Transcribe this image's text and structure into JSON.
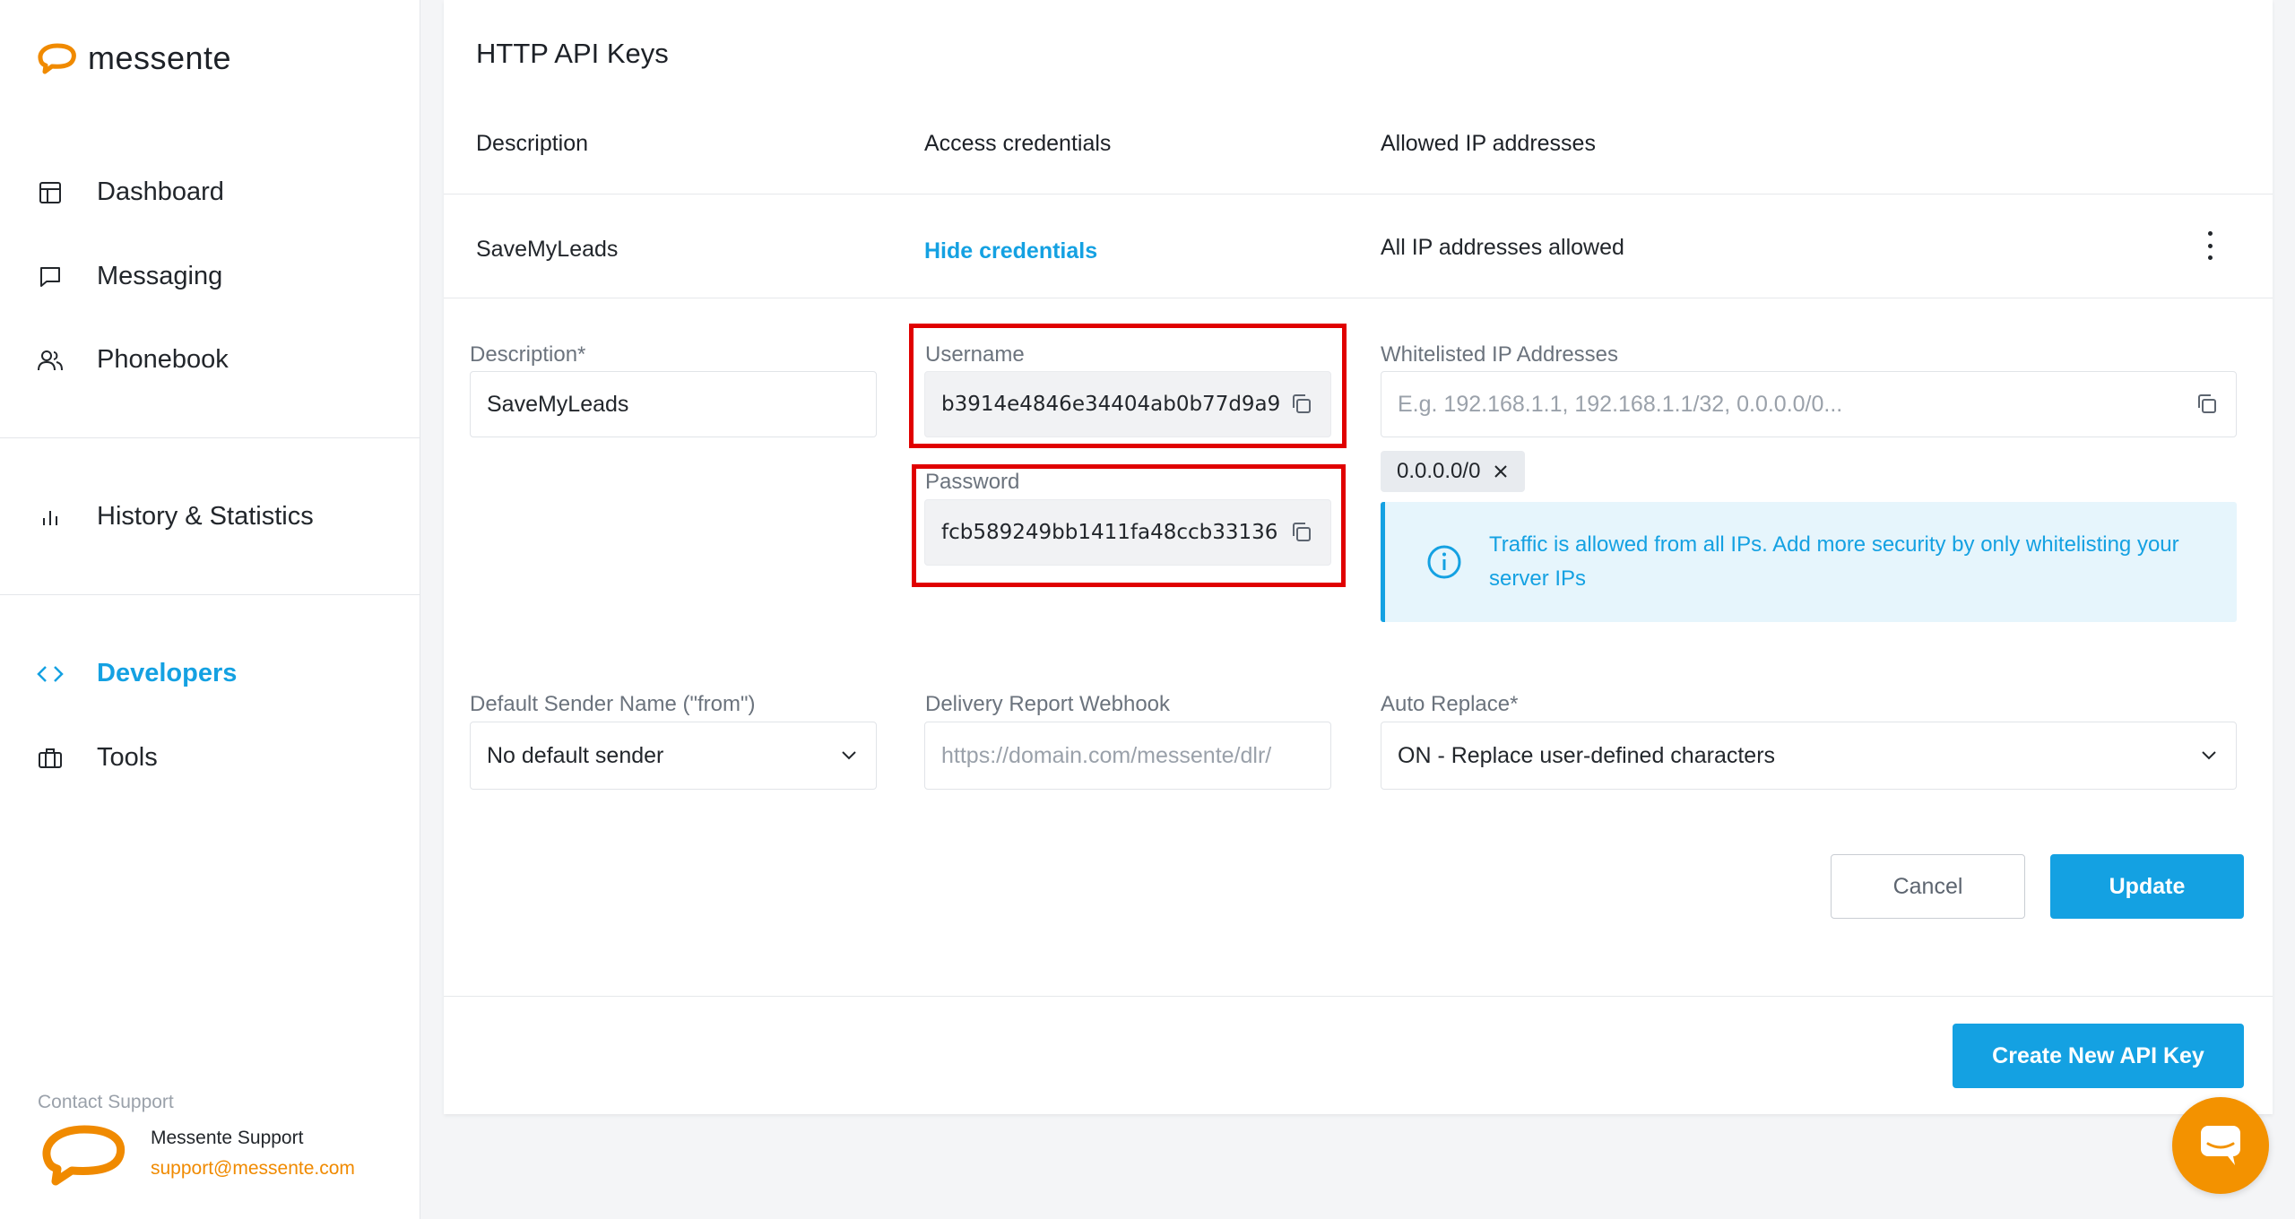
{
  "brand": {
    "name": "messente",
    "accent": "#f08a00",
    "primary": "#14a1e2"
  },
  "sidebar": {
    "items": [
      {
        "label": "Dashboard",
        "icon": "dashboard-icon"
      },
      {
        "label": "Messaging",
        "icon": "chat-icon"
      },
      {
        "label": "Phonebook",
        "icon": "people-icon"
      },
      {
        "label": "History & Statistics",
        "icon": "bar-chart-icon"
      },
      {
        "label": "Developers",
        "icon": "code-icon"
      },
      {
        "label": "Tools",
        "icon": "toolbox-icon"
      }
    ],
    "active": "Developers",
    "support": {
      "heading": "Contact Support",
      "name": "Messente Support",
      "email": "support@messente.com"
    }
  },
  "panel": {
    "title": "HTTP API Keys",
    "columns": [
      "Description",
      "Access credentials",
      "Allowed IP addresses"
    ],
    "row": {
      "description": "SaveMyLeads",
      "credentials_link": "Hide credentials",
      "allowed_ips": "All IP addresses allowed"
    }
  },
  "form": {
    "description": {
      "label": "Description*",
      "value": "SaveMyLeads"
    },
    "username": {
      "label": "Username",
      "value": "b3914e4846e34404ab0b77d9a9"
    },
    "password": {
      "label": "Password",
      "value": "fcb589249bb1411fa48ccb33136"
    },
    "whitelist": {
      "label": "Whitelisted IP Addresses",
      "placeholder": "E.g. 192.168.1.1, 192.168.1.1/32, 0.0.0.0/0...",
      "chip": "0.0.0.0/0",
      "info": "Traffic is allowed from all IPs. Add more security by only whitelisting your server IPs"
    },
    "sender": {
      "label": "Default Sender Name (\"from\")",
      "value": "No default sender"
    },
    "webhook": {
      "label": "Delivery Report Webhook",
      "placeholder": "https://domain.com/messente/dlr/"
    },
    "auto_replace": {
      "label": "Auto Replace*",
      "value": "ON - Replace user-defined characters"
    }
  },
  "buttons": {
    "cancel": "Cancel",
    "update": "Update",
    "create": "Create New API Key"
  }
}
